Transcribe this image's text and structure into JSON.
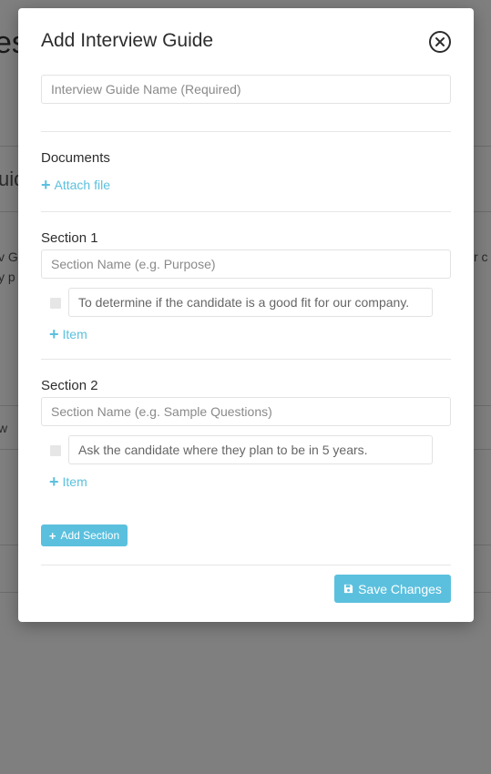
{
  "background": {
    "title_fragment": "es",
    "heading_fragment": "uid",
    "text_fragment_1": "v G",
    "text_fragment_2": "y p",
    "text_fragment_3": "r c",
    "text_fragment_4": "w"
  },
  "modal": {
    "title": "Add Interview Guide",
    "guide_name_placeholder": "Interview Guide Name (Required)",
    "documents_label": "Documents",
    "attach_file_label": "Attach file",
    "sections": [
      {
        "title": "Section 1",
        "name_placeholder": "Section Name (e.g. Purpose)",
        "item_value": "To determine if the candidate is a good fit for our company.",
        "add_item_label": "Item"
      },
      {
        "title": "Section 2",
        "name_placeholder": "Section Name (e.g. Sample Questions)",
        "item_value": "Ask the candidate where they plan to be in 5 years.",
        "add_item_label": "Item"
      }
    ],
    "add_section_label": "Add Section",
    "save_label": "Save Changes"
  },
  "colors": {
    "accent": "#5bc0de",
    "overlay": "rgba(0,0,0,0.5)",
    "text": "#2d2d2d"
  },
  "icons": {
    "close": "close-circle-icon",
    "plus": "plus-icon",
    "save": "floppy-disk-icon",
    "drag": "drag-handle-icon"
  }
}
